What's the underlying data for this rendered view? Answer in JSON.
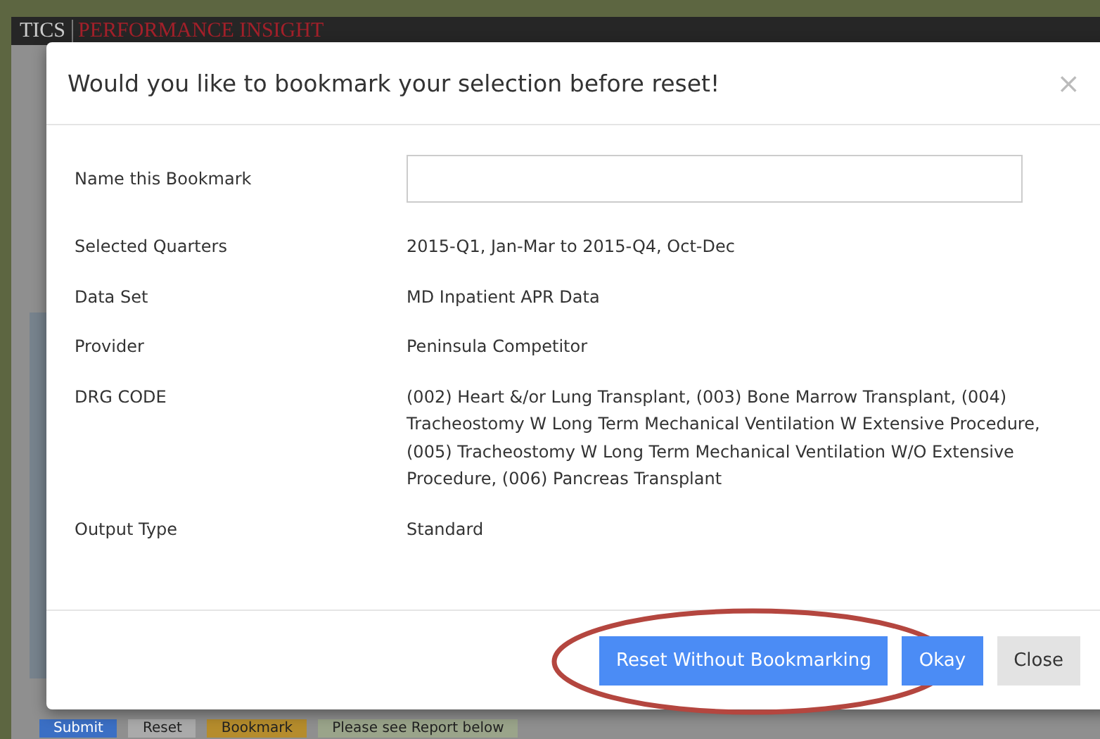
{
  "app_header": {
    "brand_left": "TICS",
    "brand_right": "PERFORMANCE INSIGHT"
  },
  "background_buttons": [
    {
      "label": "Submit",
      "kind": "primary"
    },
    {
      "label": "Reset",
      "kind": "plain"
    },
    {
      "label": "Bookmark",
      "kind": "warning"
    },
    {
      "label": "Please see Report below",
      "kind": "info"
    }
  ],
  "dialog": {
    "title": "Would you like to bookmark your selection before reset!",
    "close": "×",
    "name_field": {
      "label": "Name this Bookmark"
    },
    "fields": [
      {
        "label": "Selected Quarters",
        "value": "2015-Q1, Jan-Mar to 2015-Q4, Oct-Dec"
      },
      {
        "label": "Data Set",
        "value": "MD Inpatient APR Data"
      },
      {
        "label": "Provider",
        "value": "Peninsula Competitor"
      },
      {
        "label": "DRG CODE",
        "value": "(002) Heart &/or Lung Transplant, (003) Bone Marrow Transplant, (004) Tracheostomy W Long Term Mechanical Ventilation W Extensive Procedure, (005) Tracheostomy W Long Term Mechanical Ventilation W/O Extensive Procedure, (006) Pancreas Transplant"
      },
      {
        "label": "Output Type",
        "value": "Standard"
      }
    ],
    "buttons": [
      {
        "label": "Reset Without Bookmarking",
        "kind": "primary",
        "highlighted": true
      },
      {
        "label": "Okay",
        "kind": "primary",
        "highlighted": false
      },
      {
        "label": "Close",
        "kind": "default",
        "highlighted": false
      }
    ]
  }
}
